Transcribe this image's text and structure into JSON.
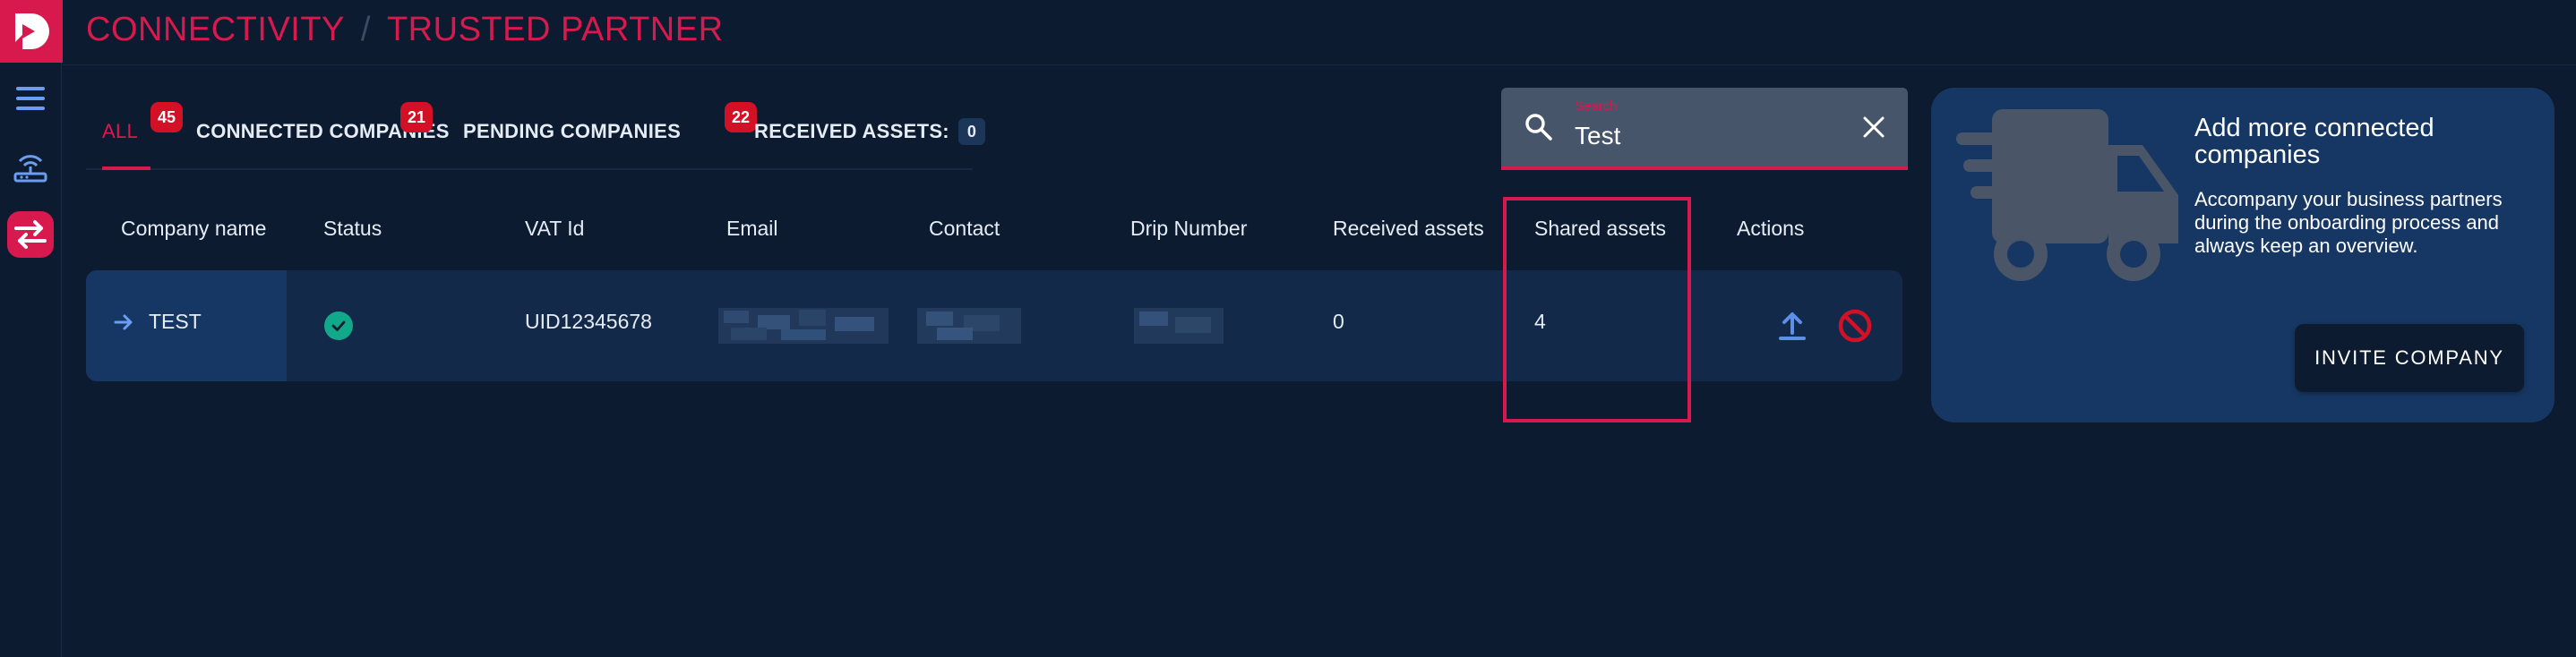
{
  "breadcrumb": {
    "root": "CONNECTIVITY",
    "separator": "/",
    "current": "TRUSTED PARTNER"
  },
  "tabs": [
    {
      "label": "ALL",
      "count": "45"
    },
    {
      "label": "CONNECTED COMPANIES",
      "count": "21"
    },
    {
      "label": "PENDING COMPANIES",
      "count": "22"
    }
  ],
  "received_assets": {
    "label": "RECEIVED ASSETS:",
    "count": "0"
  },
  "search": {
    "label": "Search",
    "value": "Test"
  },
  "table": {
    "headers": [
      "Company name",
      "Status",
      "VAT Id",
      "Email",
      "Contact",
      "Drip Number",
      "Received assets",
      "Shared assets",
      "Actions"
    ],
    "rows": [
      {
        "company": "TEST",
        "status": "connected",
        "vat": "UID12345678",
        "received": "0",
        "shared": "4"
      }
    ]
  },
  "card": {
    "title": "Add more connected companies",
    "text": "Accompany your business partners during the onboarding process and always keep an overview.",
    "button": "INVITE COMPANY"
  },
  "colors": {
    "accent": "#d7194d",
    "background": "#0c1b2f",
    "card": "#163763",
    "status_ok": "#12a88a",
    "action_upload": "#5b8fe8",
    "action_block": "#d31126"
  }
}
